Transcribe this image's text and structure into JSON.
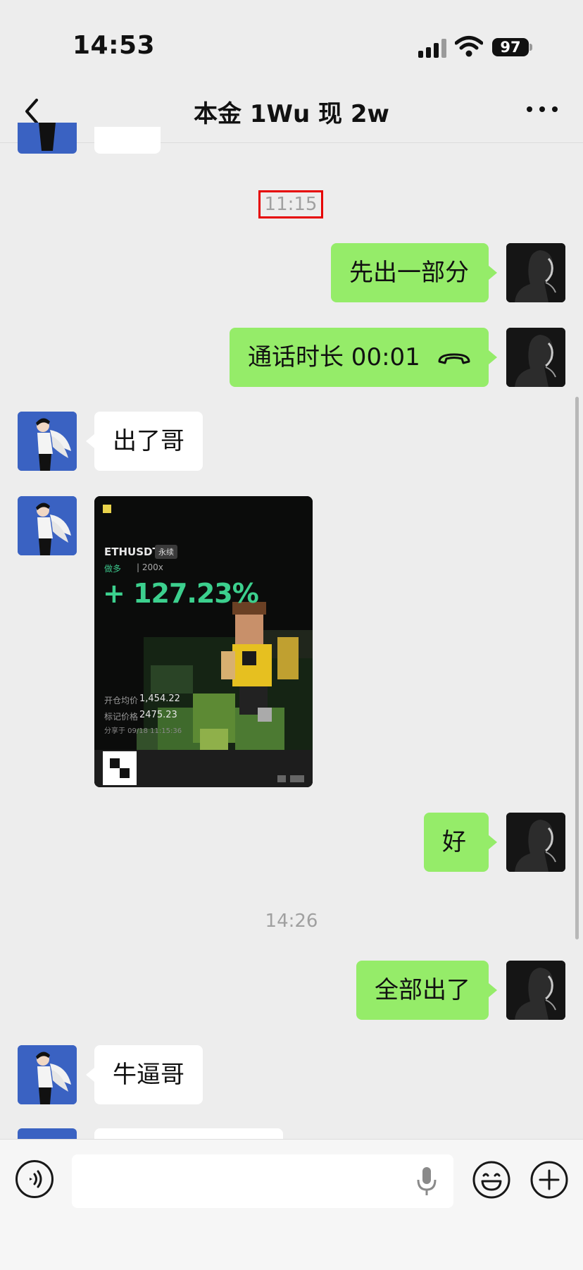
{
  "status_bar": {
    "time": "14:53",
    "battery": "97"
  },
  "nav": {
    "title": "本金 1Wu 现 2w"
  },
  "messages": {
    "time_1": "11:15",
    "m1": "先出一部分",
    "m2": "通话时长 00:01",
    "m3": "出了哥",
    "m5": "好",
    "time_2": "14:26",
    "m6": "全部出了",
    "m7": "牛逼哥"
  },
  "card": {
    "pair": "ETHUSDT",
    "tag": "永续",
    "side": "做多",
    "leverage": "| 200x",
    "pnl": "+ 127.23%",
    "open_label": "开仓均价",
    "open_value": "1,454.22",
    "mark_label": "标记价格",
    "mark_value": "2475.23",
    "share_text": "分享于 09/18 11:15:36"
  },
  "colors": {
    "bubble_self": "#95ec69",
    "bubble_other": "#ffffff",
    "background": "#ededed",
    "pnl_green": "#3cd08e",
    "highlight": "#e60000"
  },
  "icons": {
    "back": "chevron-left-icon",
    "more": "more-dots-icon",
    "call": "phone-hangup-icon",
    "voice": "voice-input-icon",
    "mic": "microphone-icon",
    "emoji": "emoji-icon",
    "plus": "plus-icon"
  }
}
